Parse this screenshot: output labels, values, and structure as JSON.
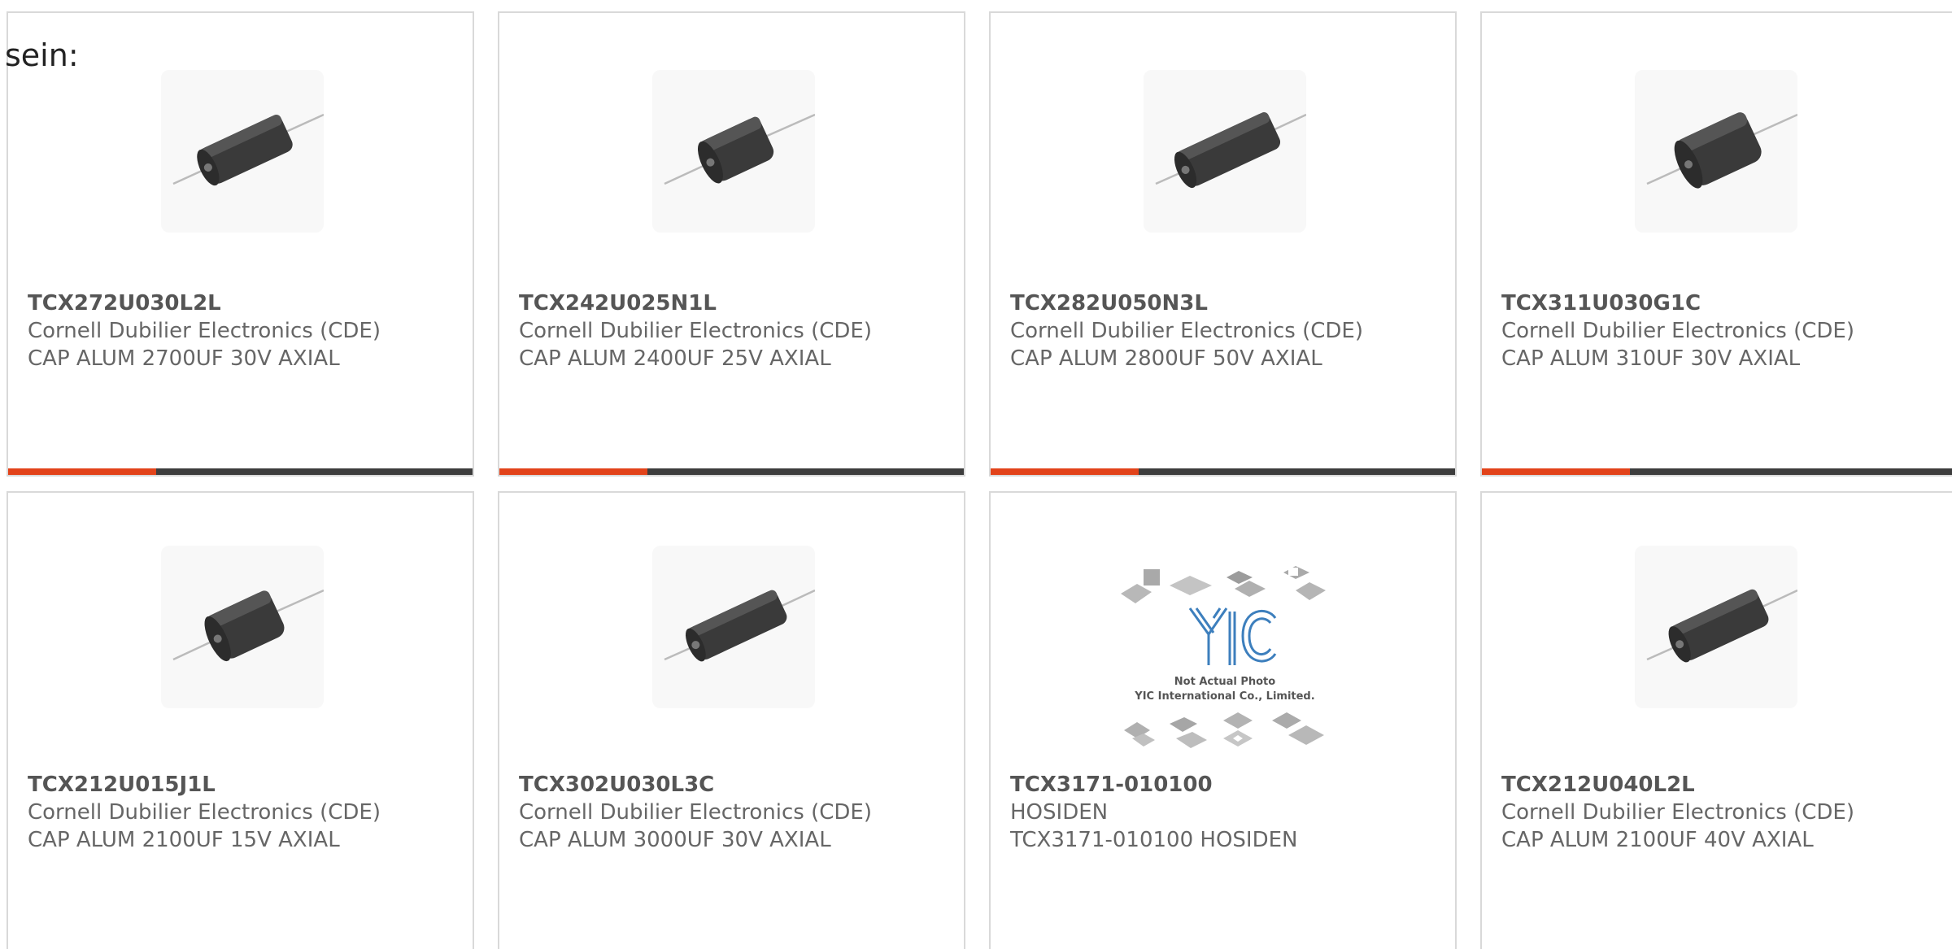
{
  "intro_text": "sein:",
  "colors": {
    "accent": "#e2431a",
    "bar": "#3d3d3d",
    "border": "#d9d9d9"
  },
  "products": [
    {
      "part_number": "TCX272U030L2L",
      "manufacturer": "Cornell Dubilier Electronics (CDE)",
      "description": "CAP ALUM 2700UF 30V AXIAL",
      "image": "axial-capacitor-icon"
    },
    {
      "part_number": "TCX242U025N1L",
      "manufacturer": "Cornell Dubilier Electronics (CDE)",
      "description": "CAP ALUM 2400UF 25V AXIAL",
      "image": "axial-capacitor-icon"
    },
    {
      "part_number": "TCX282U050N3L",
      "manufacturer": "Cornell Dubilier Electronics (CDE)",
      "description": "CAP ALUM 2800UF 50V AXIAL",
      "image": "axial-capacitor-icon"
    },
    {
      "part_number": "TCX311U030G1C",
      "manufacturer": "Cornell Dubilier Electronics (CDE)",
      "description": "CAP ALUM 310UF 30V AXIAL",
      "image": "axial-capacitor-icon"
    },
    {
      "part_number": "TCX212U015J1L",
      "manufacturer": "Cornell Dubilier Electronics (CDE)",
      "description": "CAP ALUM 2100UF 15V AXIAL",
      "image": "axial-capacitor-icon"
    },
    {
      "part_number": "TCX302U030L3C",
      "manufacturer": "Cornell Dubilier Electronics (CDE)",
      "description": "CAP ALUM 3000UF 30V AXIAL",
      "image": "axial-capacitor-icon"
    },
    {
      "part_number": "TCX3171-010100",
      "manufacturer": "HOSIDEN",
      "description": "TCX3171-010100 HOSIDEN",
      "image": "yic-placeholder-image",
      "placeholder": {
        "logo": "YIC",
        "line1": "Not Actual Photo",
        "line2": "YIC International Co., Limited."
      }
    },
    {
      "part_number": "TCX212U040L2L",
      "manufacturer": "Cornell Dubilier Electronics (CDE)",
      "description": "CAP ALUM 2100UF 40V AXIAL",
      "image": "axial-capacitor-icon"
    }
  ]
}
